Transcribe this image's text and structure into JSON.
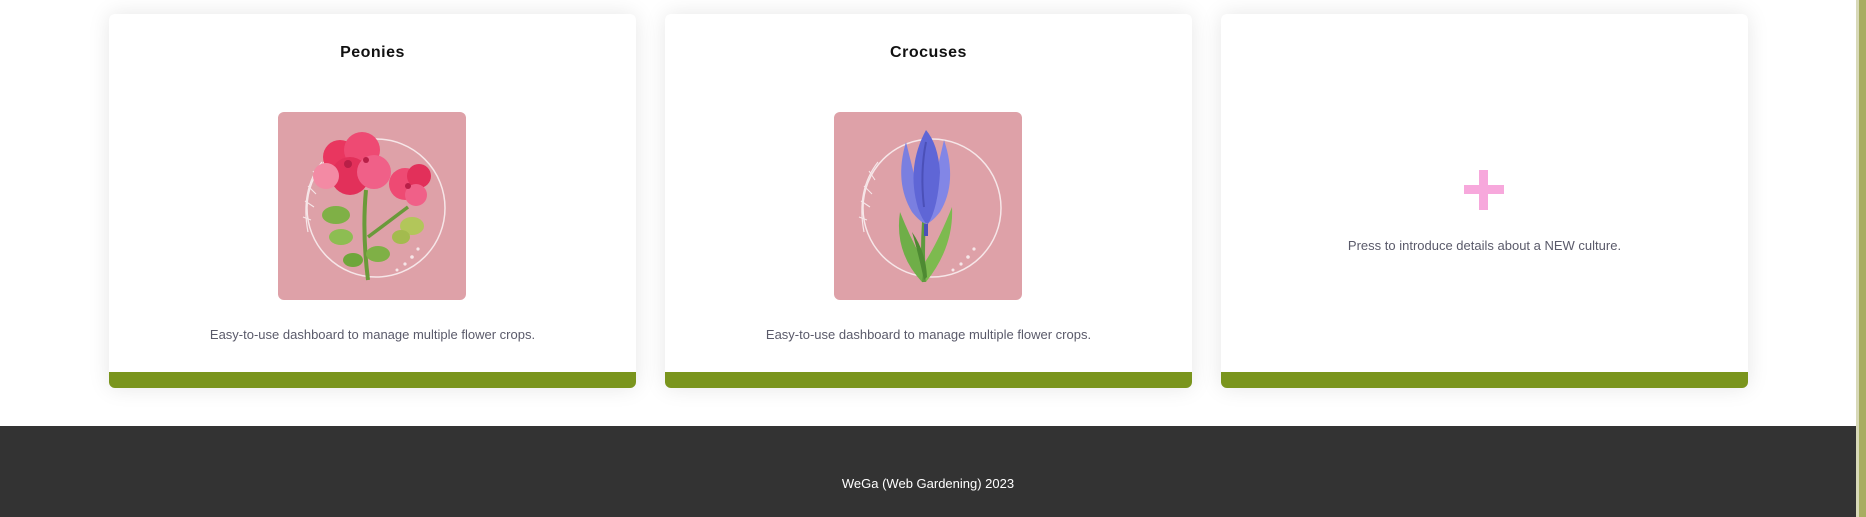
{
  "cards": [
    {
      "title": "Peonies",
      "image_icon": "peony-flower-illustration",
      "description": "Easy-to-use dashboard to manage multiple flower crops."
    },
    {
      "title": "Crocuses",
      "image_icon": "crocus-flower-illustration",
      "description": "Easy-to-use dashboard to manage multiple flower crops."
    }
  ],
  "new_card": {
    "icon": "plus-icon",
    "description": "Press to introduce details about a NEW culture."
  },
  "footer": {
    "text": "WeGa (Web Gardening) 2023"
  },
  "colors": {
    "card_footer": "#7a951d",
    "image_background": "#dea1a8",
    "plus_icon": "#f7a8dc",
    "page_footer": "#333333",
    "scrollbar": "#a8ad62"
  }
}
